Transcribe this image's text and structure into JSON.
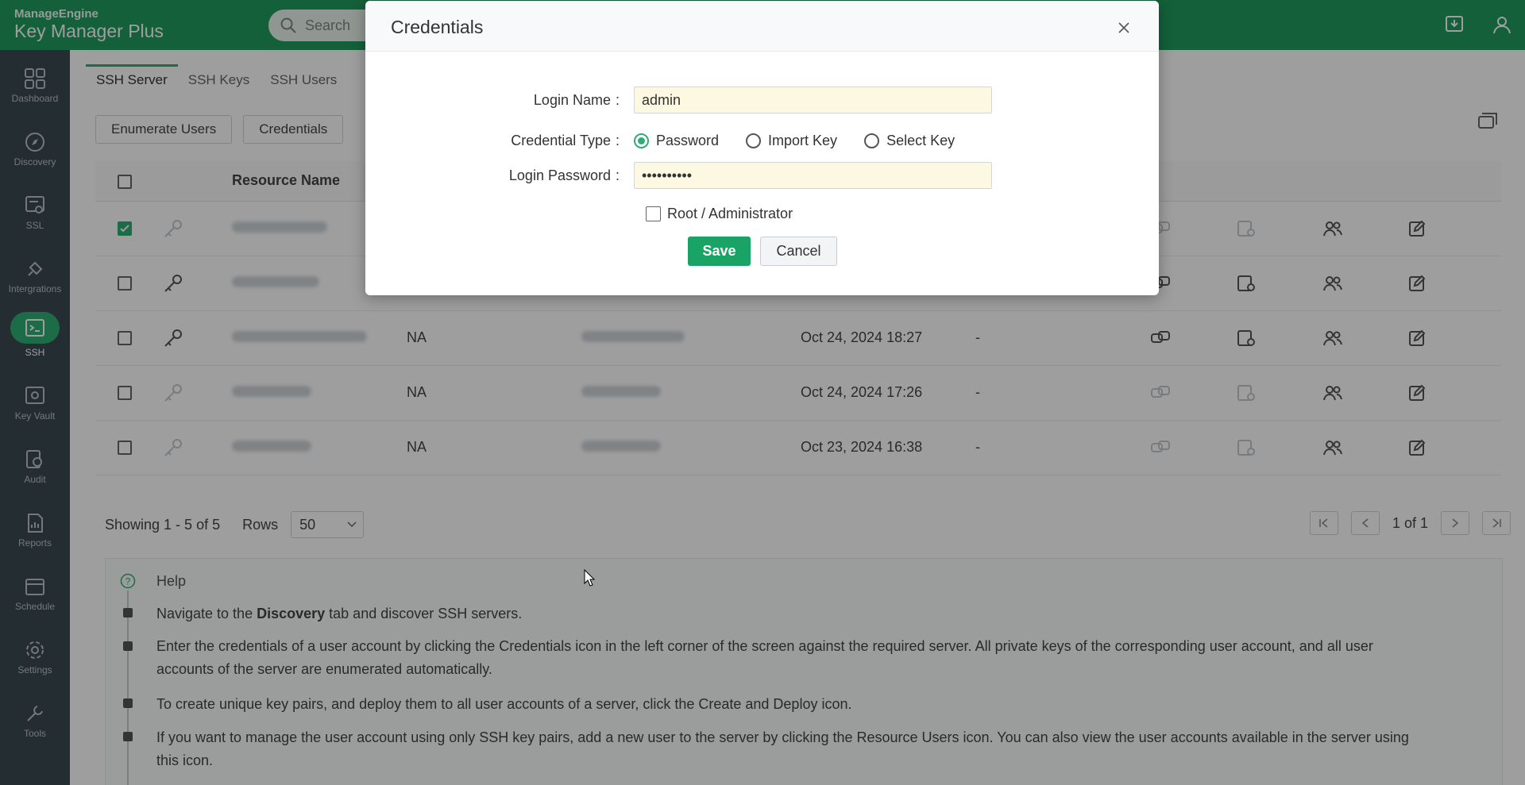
{
  "app": {
    "vendor": "ManageEngine",
    "name": "Key Manager Plus",
    "search_placeholder": "Search"
  },
  "nav": [
    {
      "label": "Dashboard",
      "icon": "dashboard-icon"
    },
    {
      "label": "Discovery",
      "icon": "compass-icon"
    },
    {
      "label": "SSL",
      "icon": "certificate-icon"
    },
    {
      "label": "Intergrations",
      "icon": "plug-icon"
    },
    {
      "label": "SSH",
      "icon": "terminal-icon"
    },
    {
      "label": "Key Vault",
      "icon": "vault-icon"
    },
    {
      "label": "Audit",
      "icon": "audit-icon"
    },
    {
      "label": "Reports",
      "icon": "reports-icon"
    },
    {
      "label": "Schedule",
      "icon": "calendar-icon"
    },
    {
      "label": "Settings",
      "icon": "gear-icon"
    },
    {
      "label": "Tools",
      "icon": "tools-icon"
    }
  ],
  "tabs": [
    "SSH Server",
    "SSH Keys",
    "SSH Users"
  ],
  "toolbar": {
    "enumerate": "Enumerate Users",
    "credentials": "Credentials"
  },
  "table": {
    "header_resource": "Resource Name",
    "rows": [
      {
        "checked": true,
        "col2": "",
        "date": "",
        "dash": ""
      },
      {
        "checked": false,
        "col2": "",
        "date": "",
        "dash": ""
      },
      {
        "checked": false,
        "col2": "NA",
        "date": "Oct 24, 2024 18:27",
        "dash": "-"
      },
      {
        "checked": false,
        "col2": "NA",
        "date": "Oct 24, 2024 17:26",
        "dash": "-"
      },
      {
        "checked": false,
        "col2": "NA",
        "date": "Oct 23, 2024 16:38",
        "dash": "-"
      }
    ]
  },
  "footer": {
    "showing": "Showing 1 - 5 of 5",
    "rows_label": "Rows",
    "rows_value": "50",
    "page": "1 of 1"
  },
  "help": {
    "title": "Help",
    "item1_pre": "Navigate to the ",
    "item1_bold": "Discovery",
    "item1_post": " tab and discover SSH servers.",
    "item2": "Enter the credentials of a user account by clicking the Credentials icon in the left corner of the screen against the required server. All private keys of the corresponding user account, and all user accounts of the server are enumerated automatically.",
    "item3": "To create unique key pairs, and deploy them to all user accounts of a server, click the Create and Deploy icon.",
    "item4": "If you want to manage the user account using only SSH key pairs, add a new user to the server by clicking the Resource Users icon. You can also view the user accounts available in the server using this icon."
  },
  "modal": {
    "title": "Credentials",
    "login_name_label": "Login Name",
    "login_name_value": "admin",
    "cred_type_label": "Credential Type",
    "options": [
      "Password",
      "Import Key",
      "Select Key"
    ],
    "selected_option": "Password",
    "login_password_label": "Login Password",
    "login_password_value": "••••••••••",
    "root_label": "Root / Administrator",
    "save": "Save",
    "cancel": "Cancel"
  },
  "colors": {
    "accent": "#2eae74",
    "topbar": "#1f9b5e",
    "sidebar": "#3b4a52"
  }
}
